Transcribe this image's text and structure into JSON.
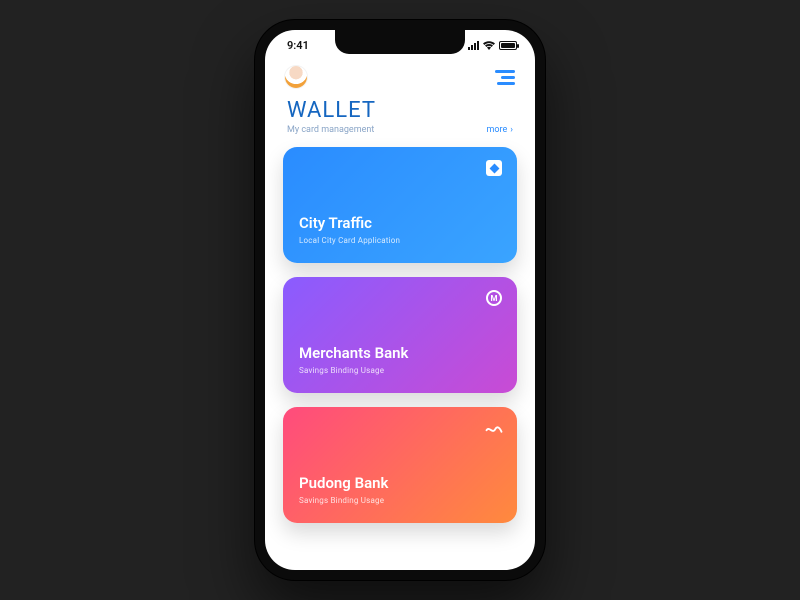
{
  "status": {
    "time": "9:41"
  },
  "header": {
    "title": "WALLET",
    "subtitle": "My card management",
    "more_label": "more"
  },
  "cards": [
    {
      "title": "City Traffic",
      "subtitle": "Local City Card Application",
      "logo": "square-icon"
    },
    {
      "title": "Merchants Bank",
      "subtitle": "Savings Binding Usage",
      "logo": "ring-m-icon"
    },
    {
      "title": "Pudong Bank",
      "subtitle": "Savings Binding Usage",
      "logo": "wave-icon"
    }
  ]
}
